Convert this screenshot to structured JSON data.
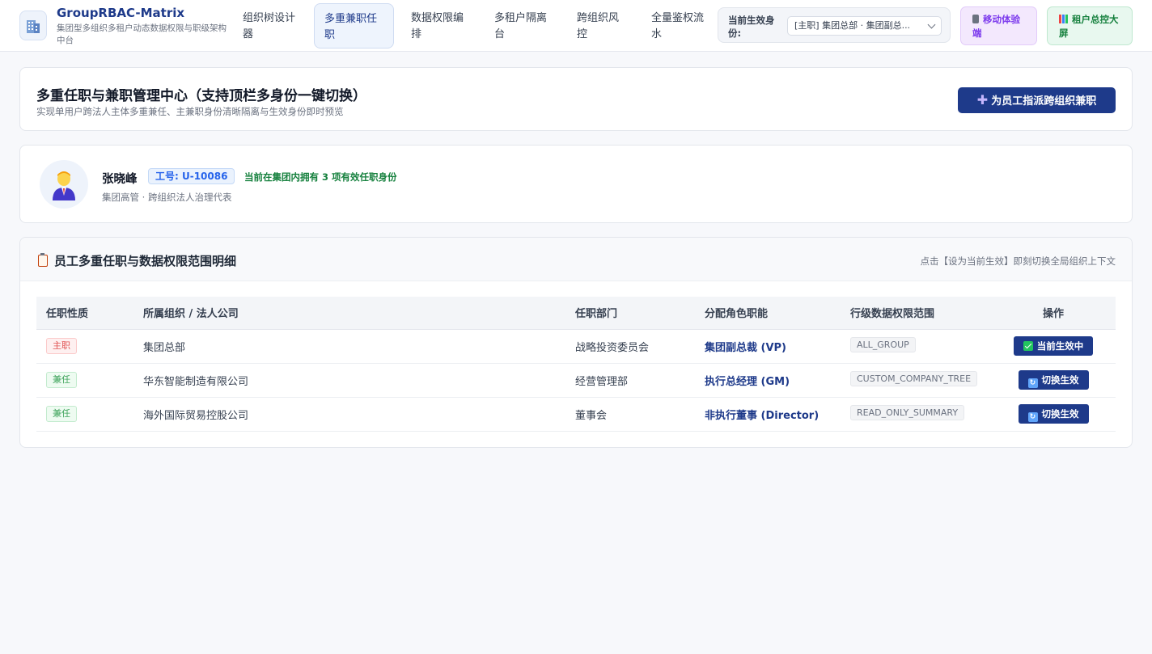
{
  "app": {
    "title": "GroupRBAC-Matrix",
    "subtitle": "集团型多组织多租户动态数据权限与职级架构中台",
    "logo_icon": "office-building-icon"
  },
  "nav": {
    "items": [
      {
        "label": "组织树设计器",
        "active": false
      },
      {
        "label": "多重兼职任职",
        "active": true
      },
      {
        "label": "数据权限编排",
        "active": false
      },
      {
        "label": "多租户隔离台",
        "active": false
      },
      {
        "label": "跨组织风控",
        "active": false
      },
      {
        "label": "全量鉴权流水",
        "active": false
      }
    ]
  },
  "identity": {
    "label": "当前生效身份:",
    "selected": "[主职] 集团总部 · 集团副总..."
  },
  "toolbar": {
    "mobile_label": "移动体验端",
    "screen_label": "租户总控大屏"
  },
  "header_card": {
    "title": "多重任职与兼职管理中心（支持顶栏多身份一键切换）",
    "subtitle": "实现单用户跨法人主体多重兼任、主兼职身份清晰隔离与生效身份即时预览",
    "assign_button": "为员工指派跨组织兼职"
  },
  "user": {
    "name": "张晓峰",
    "employee_id": "工号: U-10086",
    "hint_prefix": "当前在集团内拥有 ",
    "hint_count": "3",
    "hint_suffix": " 项有效任职身份",
    "description": "集团高管 · 跨组织法人治理代表"
  },
  "table_card": {
    "title": "员工多重任职与数据权限范围明细",
    "hint": "点击【设为当前生效】即刻切换全局组织上下文"
  },
  "table": {
    "headers": {
      "type": "任职性质",
      "org": "所属组织 / 法人公司",
      "dept": "任职部门",
      "role": "分配角色职能",
      "scope": "行级数据权限范围",
      "action": "操作"
    },
    "rows": [
      {
        "type": "主职",
        "org": "集团总部",
        "dept": "战略投资委员会",
        "role": "集团副总裁 (VP)",
        "scope": "ALL_GROUP",
        "action": "当前生效中"
      },
      {
        "type": "兼任",
        "org": "华东智能制造有限公司",
        "dept": "经营管理部",
        "role": "执行总经理 (GM)",
        "scope": "CUSTOM_COMPANY_TREE",
        "action": "切换生效"
      },
      {
        "type": "兼任",
        "org": "海外国际贸易控股公司",
        "dept": "董事会",
        "role": "非执行董事 (Director)",
        "scope": "READ_ONLY_SUMMARY",
        "action": "切换生效"
      }
    ]
  },
  "colors": {
    "brand": "#1e3a8a",
    "main_tag": "#e05252",
    "part_tag": "#3da35a",
    "success": "#15803d"
  }
}
